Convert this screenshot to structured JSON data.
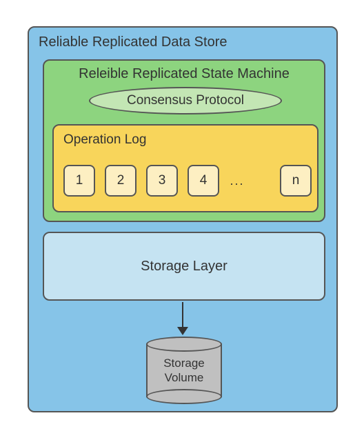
{
  "outer": {
    "title": "Reliable Replicated Data Store"
  },
  "state_machine": {
    "title": "Releible Replicated State Machine"
  },
  "consensus": {
    "label": "Consensus Protocol"
  },
  "oplog": {
    "title": "Operation Log",
    "items": [
      "1",
      "2",
      "3",
      "4"
    ],
    "ellipsis": "...",
    "last": "n"
  },
  "storage_layer": {
    "label": "Storage Layer"
  },
  "storage_volume": {
    "line1": "Storage",
    "line2": "Volume"
  }
}
